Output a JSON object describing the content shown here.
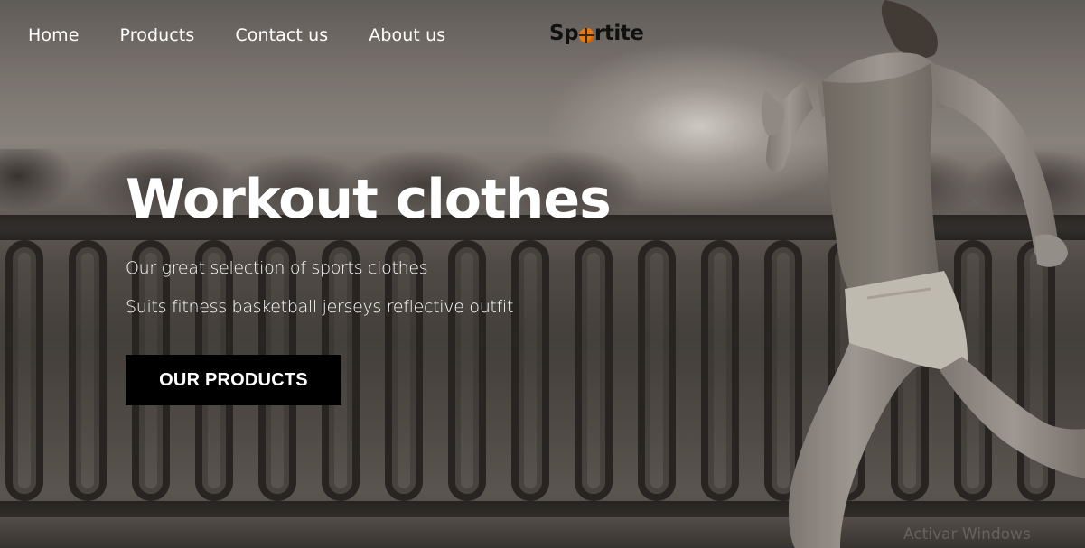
{
  "nav": {
    "items": [
      {
        "label": "Home"
      },
      {
        "label": "Products"
      },
      {
        "label": "Contact us"
      },
      {
        "label": "About us"
      }
    ]
  },
  "brand": {
    "logo_prefix": "Sp",
    "logo_suffix": "rtite",
    "logo_ball_icon": "basketball-icon",
    "accent_color": "#e67a16"
  },
  "hero": {
    "title": "Workout clothes",
    "subtitle_line1": "Our great selection of sports clothes",
    "subtitle_line2": "Suits fitness basketball jerseys reflective outfit",
    "cta_label": "OUR PRODUCTS",
    "background_image": "runner-on-bridge-photo"
  },
  "os_overlay": {
    "watermark": "Activar Windows"
  }
}
